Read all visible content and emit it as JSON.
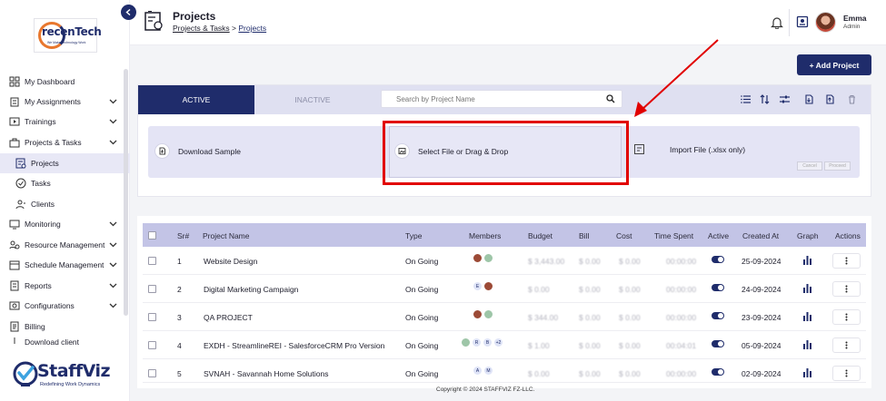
{
  "brand": {
    "company_logo_word": "recenTech",
    "company_logo_tagline": "We Make Technology Work",
    "product_name": "StaffViz",
    "product_tagline": "Redefining Work Dynamics"
  },
  "sidebar": {
    "items": [
      {
        "label": "My Dashboard"
      },
      {
        "label": "My Assignments"
      },
      {
        "label": "Trainings"
      },
      {
        "label": "Projects & Tasks"
      },
      {
        "label": "Projects"
      },
      {
        "label": "Tasks"
      },
      {
        "label": "Clients"
      },
      {
        "label": "Monitoring"
      },
      {
        "label": "Resource Management"
      },
      {
        "label": "Schedule Management"
      },
      {
        "label": "Reports"
      },
      {
        "label": "Configurations"
      },
      {
        "label": "Billing"
      },
      {
        "label": "Download client"
      }
    ]
  },
  "header": {
    "title": "Projects",
    "breadcrumb_parent": "Projects & Tasks",
    "breadcrumb_sep": ">",
    "breadcrumb_current": "Projects",
    "user_name": "Emma",
    "user_role": "Admin"
  },
  "toolbar": {
    "add_project_label": "+ Add Project",
    "tab_active": "ACTIVE",
    "tab_inactive": "INACTIVE",
    "search_placeholder": "Search by Project Name"
  },
  "import": {
    "download_sample": "Download Sample",
    "drop_label": "Select File or Drag & Drop",
    "import_label": "Import File (.xlsx only)",
    "cancel": "Cancel",
    "proceed": "Proceed"
  },
  "table": {
    "headers": [
      "Sr#",
      "Project Name",
      "Type",
      "Members",
      "Budget",
      "Bill",
      "Cost",
      "Time Spent",
      "Active",
      "Created At",
      "Graph",
      "Actions"
    ],
    "rows": [
      {
        "sr": "1",
        "name": "Website Design",
        "type": "On Going",
        "members": [
          "",
          ""
        ],
        "budget": "$ 3,443.00",
        "bill": "$ 0.00",
        "cost": "$ 0.00",
        "time": "00:00:00",
        "created": "25-09-2024"
      },
      {
        "sr": "2",
        "name": "Digital Marketing Campaign",
        "type": "On Going",
        "members": [
          "E",
          ""
        ],
        "budget": "$ 0.00",
        "bill": "$ 0.00",
        "cost": "$ 0.00",
        "time": "00:00:00",
        "created": "24-09-2024"
      },
      {
        "sr": "3",
        "name": "QA PROJECT",
        "type": "On Going",
        "members": [
          "",
          ""
        ],
        "budget": "$ 344.00",
        "bill": "$ 0.00",
        "cost": "$ 0.00",
        "time": "00:00:00",
        "created": "23-09-2024"
      },
      {
        "sr": "4",
        "name": "EXDH - StreamlineREI - SalesforceCRM Pro Version",
        "type": "On Going",
        "members": [
          "",
          "R",
          "B",
          "+2"
        ],
        "budget": "$ 1.00",
        "bill": "$ 0.00",
        "cost": "$ 0.00",
        "time": "00:04:01",
        "created": "05-09-2024"
      },
      {
        "sr": "5",
        "name": "SVNAH - Savannah Home Solutions",
        "type": "On Going",
        "members": [
          "A",
          "M"
        ],
        "budget": "$ 0.00",
        "bill": "$ 0.00",
        "cost": "$ 0.00",
        "time": "00:00:00",
        "created": "02-09-2024"
      }
    ]
  },
  "footer": {
    "copyright": "Copyright © 2024 STAFFVIZ FZ-LLC."
  },
  "colors": {
    "primary": "#1f2c6b",
    "accent": "#e8772e",
    "highlight": "#e10000",
    "tab_bar": "#dfe0f1",
    "table_header": "#c3c4e6"
  }
}
